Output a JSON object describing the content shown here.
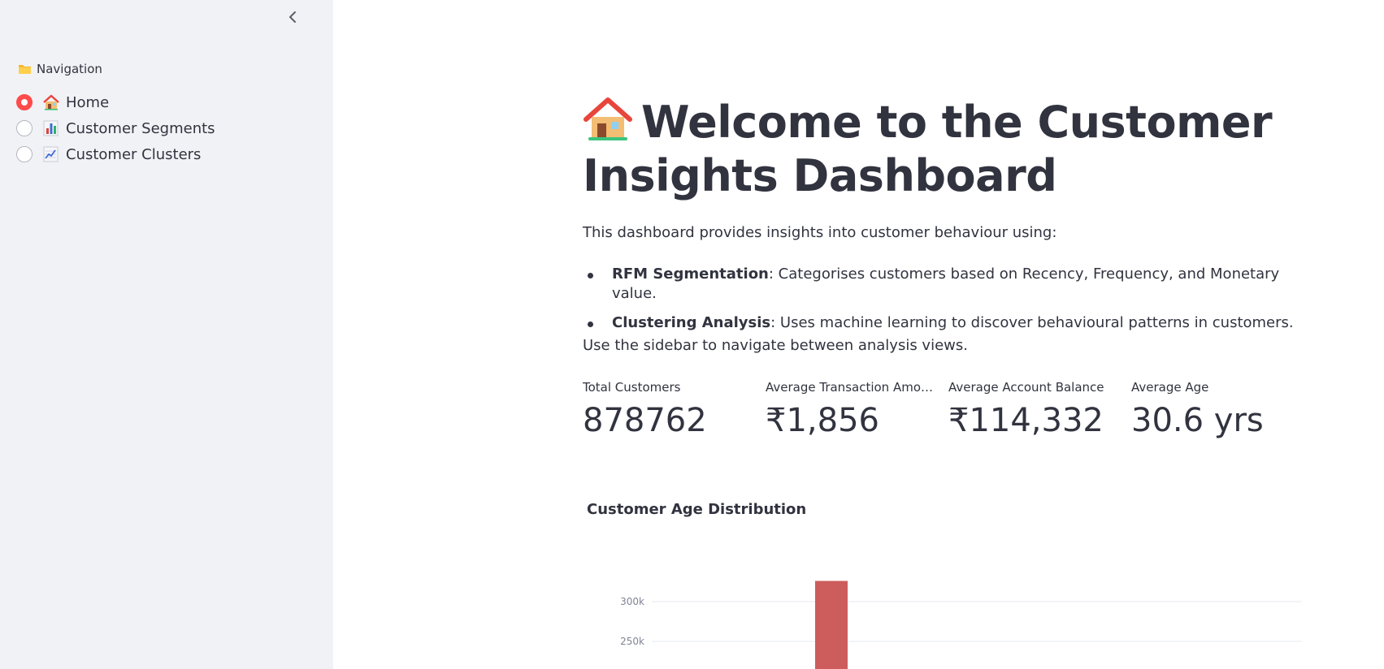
{
  "sidebar": {
    "collapse_icon": "chevron-left-icon",
    "nav_label": "Navigation",
    "nav_icon": "folder-icon",
    "items": [
      {
        "label": "Home",
        "icon": "house-icon",
        "selected": true
      },
      {
        "label": "Customer Segments",
        "icon": "bar-chart-icon",
        "selected": false
      },
      {
        "label": "Customer Clusters",
        "icon": "line-chart-icon",
        "selected": false
      }
    ]
  },
  "main": {
    "title": "Welcome to the Customer Insights Dashboard",
    "title_icon": "house-icon",
    "intro": "This dashboard provides insights into customer behaviour using:",
    "bullets": [
      {
        "bold": "RFM Segmentation",
        "text": ": Categorises customers based on Recency, Frequency, and Monetary value."
      },
      {
        "bold": "Clustering Analysis",
        "text": ": Uses machine learning to discover behavioural patterns in customers."
      }
    ],
    "outro": "Use the sidebar to navigate between analysis views.",
    "metrics": [
      {
        "label": "Total Customers",
        "value": "878762"
      },
      {
        "label": "Average Transaction Amo…",
        "value": "₹1,856"
      },
      {
        "label": "Average Account Balance",
        "value": "₹114,332"
      },
      {
        "label": "Average Age",
        "value": "30.6 yrs"
      }
    ],
    "chart_title": "Customer Age Distribution"
  },
  "colors": {
    "accent": "#ff4b4b",
    "sidebar_bg": "#f0f2f6",
    "text": "#31333f",
    "bar": "#cd5c5c"
  },
  "chart_data": {
    "type": "bar",
    "title": "Customer Age Distribution",
    "y_ticks": [
      "250k",
      "300k"
    ],
    "grid": true,
    "bars": [
      {
        "value": 326000
      }
    ]
  }
}
